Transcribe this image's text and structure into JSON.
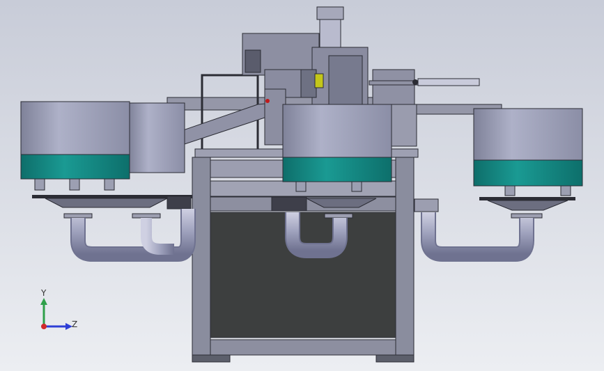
{
  "viewport": {
    "background_top": "#c8ccd8",
    "background_bottom": "#eceef2"
  },
  "model": {
    "frame_color": "#8a8d9e",
    "frame_dark": "#3c3d48",
    "bowl_body_color": "#9c9fb8",
    "bowl_band_color": "#128a84",
    "pipe_color": "#a7a9c4",
    "panel_color": "#3d3f3f"
  },
  "triad": {
    "y_label": "Y",
    "z_label": "Z",
    "y_color": "#2fa04a",
    "z_color": "#2e3fd6",
    "x_color": "#d02a2a"
  }
}
